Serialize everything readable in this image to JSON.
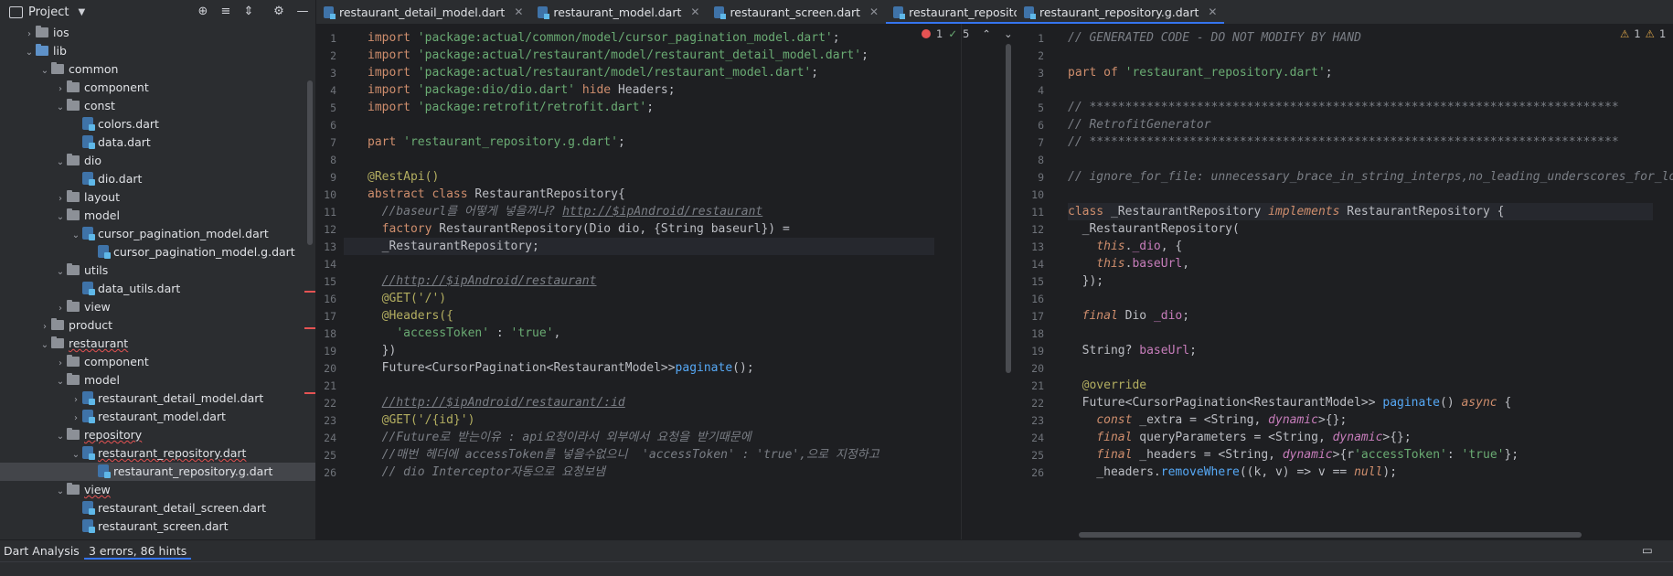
{
  "project_panel": {
    "title": "Project",
    "tree": [
      {
        "label": "ios",
        "depth": 1,
        "type": "folder",
        "expanded": false
      },
      {
        "label": "lib",
        "depth": 1,
        "type": "folder-blue",
        "expanded": true
      },
      {
        "label": "common",
        "depth": 2,
        "type": "folder",
        "expanded": true
      },
      {
        "label": "component",
        "depth": 3,
        "type": "folder",
        "expanded": false
      },
      {
        "label": "const",
        "depth": 3,
        "type": "folder",
        "expanded": true
      },
      {
        "label": "colors.dart",
        "depth": 4,
        "type": "file"
      },
      {
        "label": "data.dart",
        "depth": 4,
        "type": "file"
      },
      {
        "label": "dio",
        "depth": 3,
        "type": "folder",
        "expanded": true
      },
      {
        "label": "dio.dart",
        "depth": 4,
        "type": "file"
      },
      {
        "label": "layout",
        "depth": 3,
        "type": "folder",
        "expanded": false
      },
      {
        "label": "model",
        "depth": 3,
        "type": "folder",
        "expanded": true
      },
      {
        "label": "cursor_pagination_model.dart",
        "depth": 4,
        "type": "file-expanded"
      },
      {
        "label": "cursor_pagination_model.g.dart",
        "depth": 5,
        "type": "file"
      },
      {
        "label": "utils",
        "depth": 3,
        "type": "folder",
        "expanded": true
      },
      {
        "label": "data_utils.dart",
        "depth": 4,
        "type": "file"
      },
      {
        "label": "view",
        "depth": 3,
        "type": "folder",
        "expanded": false
      },
      {
        "label": "product",
        "depth": 2,
        "type": "folder",
        "expanded": false
      },
      {
        "label": "restaurant",
        "depth": 2,
        "type": "folder",
        "expanded": true,
        "error": true
      },
      {
        "label": "component",
        "depth": 3,
        "type": "folder",
        "expanded": false
      },
      {
        "label": "model",
        "depth": 3,
        "type": "folder",
        "expanded": true
      },
      {
        "label": "restaurant_detail_model.dart",
        "depth": 4,
        "type": "file-collapsed"
      },
      {
        "label": "restaurant_model.dart",
        "depth": 4,
        "type": "file-collapsed"
      },
      {
        "label": "repository",
        "depth": 3,
        "type": "folder",
        "expanded": true,
        "error": true
      },
      {
        "label": "restaurant_repository.dart",
        "depth": 4,
        "type": "file-expanded",
        "error": true
      },
      {
        "label": "restaurant_repository.g.dart",
        "depth": 5,
        "type": "file",
        "selected": true
      },
      {
        "label": "view",
        "depth": 3,
        "type": "folder",
        "expanded": true,
        "error": true
      },
      {
        "label": "restaurant_detail_screen.dart",
        "depth": 4,
        "type": "file"
      },
      {
        "label": "restaurant_screen.dart",
        "depth": 4,
        "type": "file"
      }
    ]
  },
  "tabs_left": [
    {
      "label": "restaurant_detail_model.dart",
      "active": false
    },
    {
      "label": "restaurant_model.dart",
      "active": false
    },
    {
      "label": "restaurant_screen.dart",
      "active": false
    },
    {
      "label": "restaurant_repository.dart",
      "active": true
    }
  ],
  "tabs_right": [
    {
      "label": "restaurant_repository.g.dart",
      "active": true
    }
  ],
  "inspection_left": {
    "errors": "1",
    "warnings": "5"
  },
  "inspection_right": {
    "warnings": "1",
    "weak": "1"
  },
  "status_bar": {
    "tool": "Dart Analysis",
    "summary": "3 errors, 86 hints"
  },
  "colors": {
    "accent": "#3574f0",
    "error": "#e55353",
    "keyword": "#cf8e6d",
    "string": "#6aab73",
    "function": "#56a8f5"
  }
}
